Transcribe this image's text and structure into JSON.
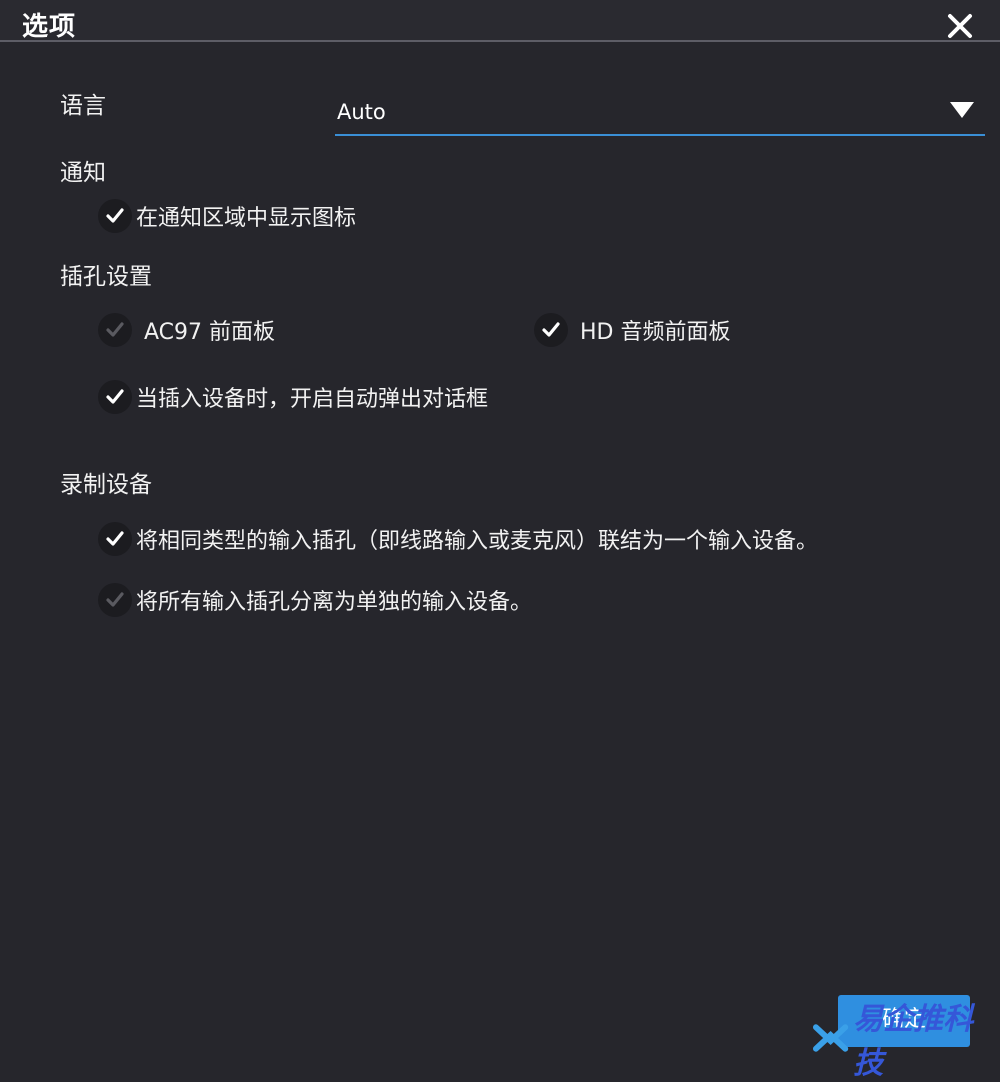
{
  "dialog": {
    "title": "选项",
    "close_icon": "close-icon"
  },
  "language": {
    "label": "语言",
    "selected": "Auto",
    "arrow_icon": "dropdown-triangle-icon"
  },
  "notification": {
    "label": "通知",
    "show_tray_icon": {
      "label": "在通知区域中显示图标",
      "checked": true
    }
  },
  "jack_settings": {
    "label": "插孔设置",
    "ac97": {
      "label": "AC97 前面板",
      "checked": false
    },
    "hd": {
      "label": "HD 音频前面板",
      "checked": true
    },
    "popup_on_plug": {
      "label": "当插入设备时，开启自动弹出对话框",
      "checked": true
    }
  },
  "recording": {
    "label": "录制设备",
    "combine": {
      "label": "将相同类型的输入插孔（即线路输入或麦克风）联结为一个输入设备。",
      "checked": true
    },
    "separate": {
      "label": "将所有输入插孔分离为单独的输入设备。",
      "checked": false
    }
  },
  "footer": {
    "ok_label": "确定"
  },
  "watermark": {
    "text": "易企推科技"
  },
  "colors": {
    "background": "#26262c",
    "accent": "#2f8fe0",
    "check_on": "#ffffff",
    "check_off": "#5a5a60"
  }
}
